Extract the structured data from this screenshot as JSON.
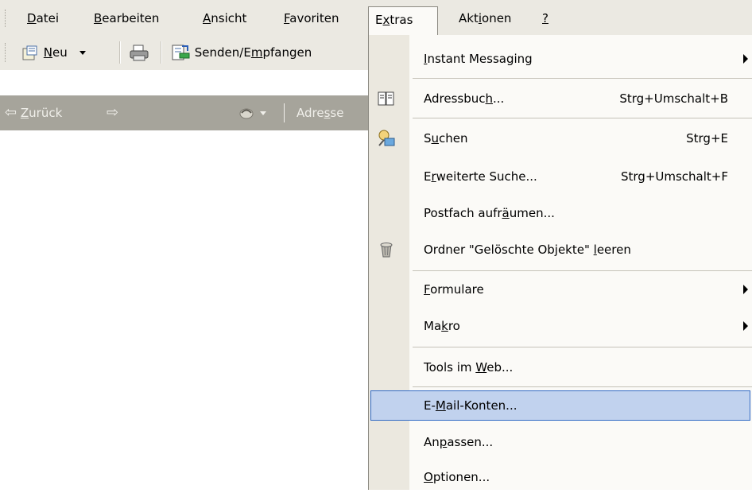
{
  "menubar": {
    "items": [
      {
        "pre": "",
        "acc": "D",
        "post": "atei"
      },
      {
        "pre": "",
        "acc": "B",
        "post": "earbeiten"
      },
      {
        "pre": "",
        "acc": "A",
        "post": "nsicht"
      },
      {
        "pre": "",
        "acc": "F",
        "post": "avoriten"
      },
      {
        "pre": "E",
        "acc": "x",
        "post": "tras"
      },
      {
        "pre": "Akt",
        "acc": "i",
        "post": "onen"
      },
      {
        "pre": "",
        "acc": "?",
        "post": ""
      }
    ]
  },
  "toolbar": {
    "new_acc": "N",
    "new_post": "eu",
    "send_pre": "Senden/E",
    "send_acc": "m",
    "send_post": "pfangen"
  },
  "navbar": {
    "back_acc": "Z",
    "back_post": "urück",
    "address_pre": "Adre",
    "address_acc": "s",
    "address_post": "se"
  },
  "dropdown": {
    "instant_messaging": {
      "pre": "",
      "acc": "I",
      "post": "nstant Messaging"
    },
    "adressbuch": {
      "pre": "Adressbuc",
      "acc": "h",
      "post": "...",
      "shortcut": "Strg+Umschalt+B"
    },
    "suchen": {
      "pre": "S",
      "acc": "u",
      "post": "chen",
      "shortcut": "Strg+E"
    },
    "erweiterte_suche": {
      "pre": "E",
      "acc": "r",
      "post": "weiterte Suche...",
      "shortcut": "Strg+Umschalt+F"
    },
    "postfach": {
      "pre": "Postfach aufr",
      "acc": "ä",
      "post": "umen..."
    },
    "ordner_leeren": {
      "pre": "Ordner \"Gelöschte Objekte\" ",
      "acc": "l",
      "post": "eeren"
    },
    "formulare": {
      "pre": "",
      "acc": "F",
      "post": "ormulare"
    },
    "makro": {
      "pre": "Ma",
      "acc": "k",
      "post": "ro"
    },
    "tools_web": {
      "pre": "Tools im ",
      "acc": "W",
      "post": "eb..."
    },
    "email_konten": {
      "pre": "E-",
      "acc": "M",
      "post": "ail-Konten..."
    },
    "anpassen": {
      "pre": "An",
      "acc": "p",
      "post": "assen..."
    },
    "optionen": {
      "pre": "",
      "acc": "O",
      "post": "ptionen..."
    }
  },
  "colors": {
    "menubar_bg": "#ebe9e2",
    "navbar_bg": "#a6a49b",
    "menu_bg": "#fbfaf7",
    "gutter_bg": "#ebe8df",
    "highlight_bg": "#c1d2ee",
    "highlight_border": "#316ac5"
  }
}
